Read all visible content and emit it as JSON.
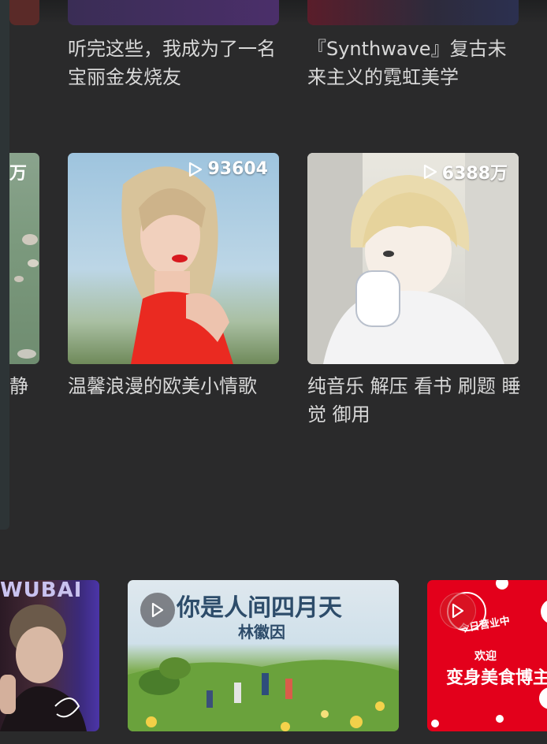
{
  "row1": {
    "items": [
      {
        "title": "听完这些，我成为了一名宝丽金发烧友"
      },
      {
        "title": "『Synthwave』复古未来主义的霓虹美学"
      }
    ]
  },
  "row2": {
    "items": [
      {
        "count": "万",
        "title": "静"
      },
      {
        "count": "93604",
        "title": "温馨浪漫的欧美小情歌"
      },
      {
        "count": "6388万",
        "title": "纯音乐 解压 看书 刷题 睡觉 御用"
      }
    ]
  },
  "row3": {
    "items": [
      {
        "cover_text": "WUBAI"
      },
      {
        "cover_title": "你是人间四月天",
        "cover_author": "林徽因"
      },
      {
        "cover_badge": "今日营业中",
        "cover_sub": "欢迎",
        "cover_title": "变身美食博主"
      }
    ]
  },
  "icons": {
    "play": "play-icon",
    "play_outline": "play-outline-icon"
  },
  "colors": {
    "background": "#2a2a2b",
    "text": "#d8d8d8",
    "accent_red": "#e3001b"
  }
}
